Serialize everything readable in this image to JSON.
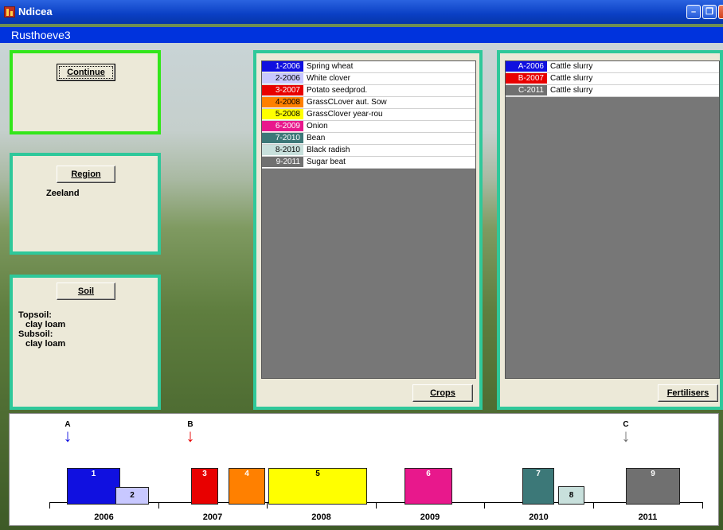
{
  "window": {
    "title": "Ndicea",
    "subtitle": "Rusthoeve3",
    "min": "–",
    "restore": "❐",
    "close": "✕"
  },
  "continue_label": "Continue",
  "region": {
    "button": "Region",
    "value": "Zeeland"
  },
  "soil": {
    "button": "Soil",
    "topsoil_label": "Topsoil:",
    "topsoil_value": "clay loam",
    "subsoil_label": "Subsoil:",
    "subsoil_value": "clay loam"
  },
  "crops": {
    "button": "Crops",
    "items": [
      {
        "code": "1-2006",
        "name": "Spring wheat",
        "color": "#1010e0",
        "text": "#ffffff"
      },
      {
        "code": "2-2006",
        "name": "White clover",
        "color": "#c8c8ff",
        "text": "#000000"
      },
      {
        "code": "3-2007",
        "name": "Potato seedprod.",
        "color": "#e80000",
        "text": "#ffffff"
      },
      {
        "code": "4-2008",
        "name": "GrassCLover aut. Sow",
        "color": "#ff8000",
        "text": "#000000"
      },
      {
        "code": "5-2008",
        "name": "GrassClover year-rou",
        "color": "#ffff00",
        "text": "#000000"
      },
      {
        "code": "6-2009",
        "name": "Onion",
        "color": "#e8188c",
        "text": "#ffffff"
      },
      {
        "code": "7-2010",
        "name": "Bean",
        "color": "#3c7878",
        "text": "#ffffff"
      },
      {
        "code": "8-2010",
        "name": "Black radish",
        "color": "#c8e0dc",
        "text": "#000000"
      },
      {
        "code": "9-2011",
        "name": "Sugar beat",
        "color": "#707070",
        "text": "#ffffff"
      }
    ]
  },
  "fertilisers": {
    "button": "Fertilisers",
    "items": [
      {
        "code": "A-2006",
        "name": "Cattle slurry",
        "color": "#1010e0",
        "text": "#ffffff"
      },
      {
        "code": "B-2007",
        "name": "Cattle slurry",
        "color": "#e80000",
        "text": "#ffffff"
      },
      {
        "code": "C-2011",
        "name": "Cattle slurry",
        "color": "#707070",
        "text": "#ffffff"
      }
    ]
  },
  "timeline": {
    "years": [
      "2006",
      "2007",
      "2008",
      "2009",
      "2010",
      "2011"
    ],
    "bars": [
      {
        "label": "1",
        "color": "#1010e0"
      },
      {
        "label": "2",
        "color": "#c8c8ff"
      },
      {
        "label": "3",
        "color": "#e80000"
      },
      {
        "label": "4",
        "color": "#ff8000"
      },
      {
        "label": "5",
        "color": "#ffff00"
      },
      {
        "label": "6",
        "color": "#e8188c"
      },
      {
        "label": "7",
        "color": "#3c7878"
      },
      {
        "label": "8",
        "color": "#c8e0dc"
      },
      {
        "label": "9",
        "color": "#707070"
      }
    ],
    "markers": [
      {
        "label": "A",
        "color": "#1010e0"
      },
      {
        "label": "B",
        "color": "#e80000"
      },
      {
        "label": "C",
        "color": "#707070"
      }
    ]
  }
}
